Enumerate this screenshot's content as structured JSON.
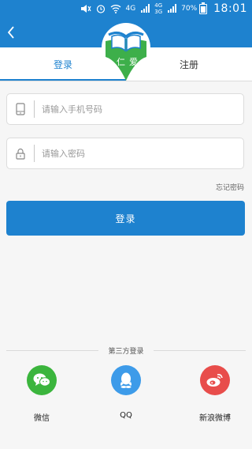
{
  "status_bar": {
    "network": "4G",
    "network2": "4G",
    "network3": "3G",
    "battery": "70%",
    "time": "18:01",
    "battery_level": 0.7
  },
  "tabs": {
    "login": "登录",
    "register": "注册"
  },
  "logo": {
    "text_left": "仁",
    "text_right": "爱"
  },
  "form": {
    "phone_placeholder": "请输入手机号码",
    "phone_value": "",
    "password_placeholder": "请输入密码",
    "password_value": "",
    "forgot_password": "忘记密码",
    "login_button": "登录"
  },
  "third_party": {
    "title": "第三方登录",
    "items": [
      {
        "label": "微信",
        "icon": "wechat-icon",
        "color": "#3bb53d"
      },
      {
        "label": "QQ",
        "icon": "qq-icon",
        "color": "#3d9be9"
      },
      {
        "label": "新浪微博",
        "icon": "weibo-icon",
        "color": "#e84d4b"
      }
    ]
  },
  "colors": {
    "primary": "#1e82cf",
    "background": "#f6f6f6",
    "logo_green": "#3daf4a"
  }
}
